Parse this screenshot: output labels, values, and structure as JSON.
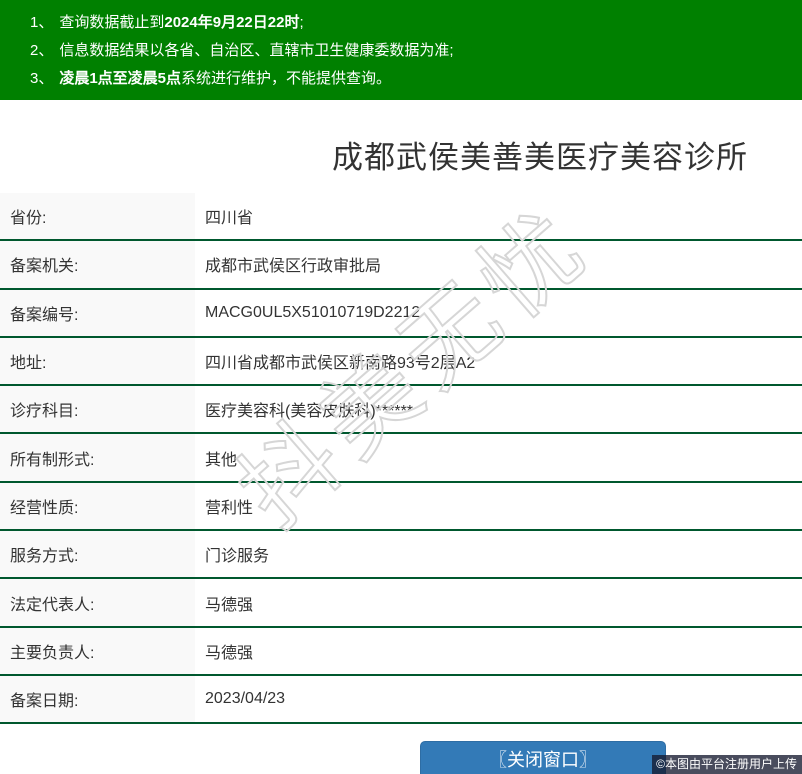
{
  "colors": {
    "header_green": "#008000",
    "divider_green": "#00582e",
    "label_bg": "#f9f9f9",
    "text": "#333333",
    "button_blue": "#337ab7",
    "watermark_gray": "#d6d6d6"
  },
  "notice_bar": {
    "items": [
      {
        "num": "1、",
        "pre": "查询数据截止到",
        "bold": "2024年9月22日22时",
        "post": ";"
      },
      {
        "num": "2、",
        "pre": "信息数据结果以各省、自治区、直辖市卫生健康委数据为准;",
        "bold": "",
        "post": ""
      },
      {
        "num": "3、",
        "pre": "",
        "bold": "凌晨1点至凌晨5点",
        "post": "系统进行维护，不能提供查询。"
      }
    ]
  },
  "title": "成都武侯美善美医疗美容诊所",
  "table": {
    "rows": [
      {
        "label": "省份:",
        "value": "四川省"
      },
      {
        "label": "备案机关:",
        "value": "成都市武侯区行政审批局"
      },
      {
        "label": "备案编号:",
        "value": "MACG0UL5X51010719D2212"
      },
      {
        "label": "地址:",
        "value": "四川省成都市武侯区新南路93号2层A2"
      },
      {
        "label": "诊疗科目:",
        "value": "医疗美容科(美容皮肤科)******"
      },
      {
        "label": "所有制形式:",
        "value": "其他"
      },
      {
        "label": "经营性质:",
        "value": "营利性"
      },
      {
        "label": "服务方式:",
        "value": "门诊服务"
      },
      {
        "label": "法定代表人:",
        "value": "马德强"
      },
      {
        "label": "主要负责人:",
        "value": "马德强"
      },
      {
        "label": "备案日期:",
        "value": "2023/04/23"
      }
    ]
  },
  "watermark": "抖美无忧",
  "close_button_label": "〖关闭窗口〗",
  "attribution": "©本图由平台注册用户上传"
}
